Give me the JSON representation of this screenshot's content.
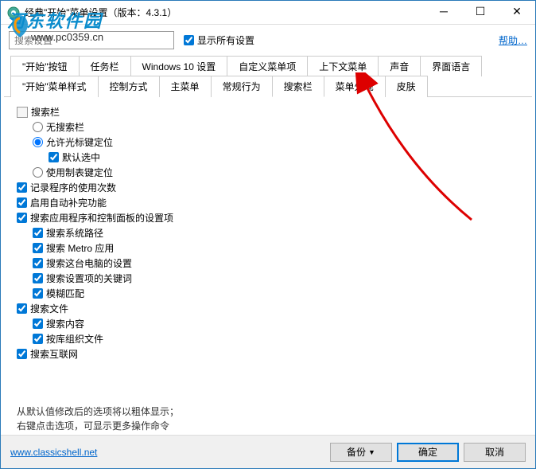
{
  "window": {
    "title": "经典\"开始\"菜单设置（版本：4.3.1）"
  },
  "watermark": {
    "text": "河东软件园",
    "url": "www.pc0359.cn"
  },
  "topbar": {
    "search_placeholder": "搜索设置",
    "show_all": "显示所有设置",
    "help": "帮助…"
  },
  "tabs_row1": [
    "\"开始\"按钮",
    "任务栏",
    "Windows 10 设置",
    "自定义菜单项",
    "上下文菜单",
    "声音",
    "界面语言"
  ],
  "tabs_row2": [
    "\"开始\"菜单样式",
    "控制方式",
    "主菜单",
    "常规行为",
    "搜索栏",
    "菜单外观",
    "皮肤"
  ],
  "active_tab": "搜索栏",
  "tree": {
    "section_title": "搜索栏",
    "radio_no_search": "无搜索栏",
    "radio_allow_cursor": "允许光标键定位",
    "check_default_selected": "默认选中",
    "radio_use_tab": "使用制表键定位",
    "check_record_usage": "记录程序的使用次数",
    "check_auto_complete": "启用自动补完功能",
    "check_search_apps": "搜索应用程序和控制面板的设置项",
    "check_search_syspath": "搜索系统路径",
    "check_search_metro": "搜索 Metro 应用",
    "check_search_pc_settings": "搜索这台电脑的设置",
    "check_search_keywords": "搜索设置项的关键词",
    "check_fuzzy_match": "模糊匹配",
    "check_search_files": "搜索文件",
    "check_search_content": "搜索内容",
    "check_library_org": "按库组织文件",
    "check_search_internet": "搜索互联网"
  },
  "footer": {
    "line1": "从默认值修改后的选项将以粗体显示；",
    "line2": "右键点击选项，可显示更多操作命令"
  },
  "bottom": {
    "link": "www.classicshell.net",
    "backup": "备份",
    "ok": "确定",
    "cancel": "取消"
  }
}
